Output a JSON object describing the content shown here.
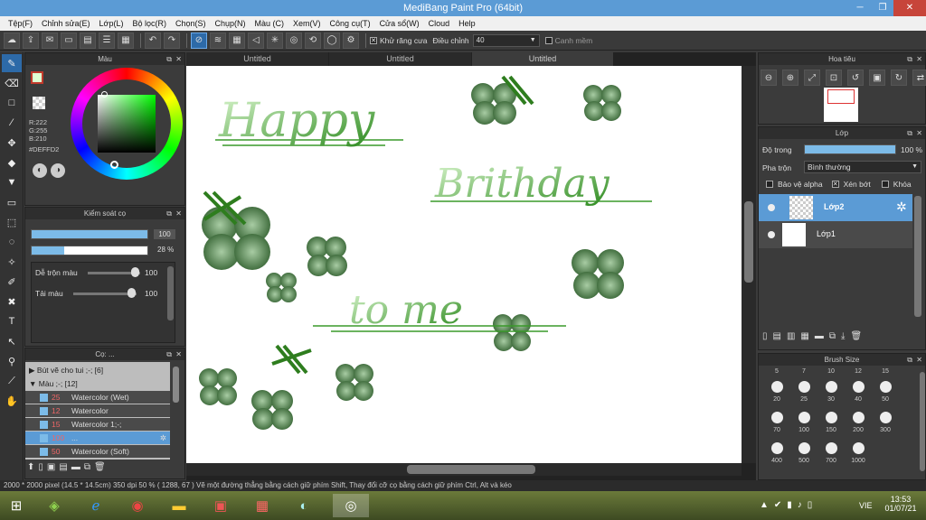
{
  "window": {
    "title": "MediBang Paint Pro (64bit)",
    "minimize": "─",
    "restore": "❐",
    "close": "✕"
  },
  "menu": [
    "Tệp(F)",
    "Chỉnh sửa(E)",
    "Lớp(L)",
    "Bộ lọc(R)",
    "Chọn(S)",
    "Chụp(N)",
    "Màu (C)",
    "Xem(V)",
    "Công cụ(T)",
    "Cửa sổ(W)",
    "Cloud",
    "Help"
  ],
  "toolbar": {
    "antialias_label": "Khử răng cưa",
    "correction_label": "Điều chỉnh",
    "correction_value": "40",
    "smooth_label": "Canh mềm"
  },
  "color_panel": {
    "title": "Màu",
    "r": "R:222",
    "g": "G:255",
    "b": "B:210",
    "hex": "#DEFFD2",
    "fg_color": "#DEFFD2"
  },
  "brush_control": {
    "title": "Kiểm soát cọ",
    "size_value": "100",
    "opacity_value": "28 %",
    "blend_label": "Dễ trộn màu",
    "blend_value": "100",
    "ink_label": "Tải màu",
    "ink_value": "100"
  },
  "brushes": {
    "title": "Cọ: ...",
    "groups": [
      {
        "label": "Bút vẽ cho tui ;-; [6]",
        "expanded": false
      },
      {
        "label": "Màu ;-; [12]",
        "expanded": true
      }
    ],
    "items": [
      {
        "size": "25",
        "name": "Watercolor (Wet)",
        "selected": false
      },
      {
        "size": "12",
        "name": "Watercolor",
        "selected": false
      },
      {
        "size": "15",
        "name": "Watercolor 1;-;",
        "selected": false
      },
      {
        "size": "100",
        "name": "...",
        "selected": true
      },
      {
        "size": "50",
        "name": "Watercolor (Soft)",
        "selected": false
      }
    ]
  },
  "tabs": [
    "Untitled",
    "Untitled",
    "Untitled"
  ],
  "canvas_text": [
    "Happy",
    "Brithday",
    "to me"
  ],
  "navigator": {
    "title": "Hoa tiêu"
  },
  "layers": {
    "title": "Lớp",
    "opacity_label": "Độ trong",
    "opacity_value": "100 %",
    "blend_label": "Pha trộn",
    "blend_value": "Bình thường",
    "alpha_label": "Bảo vệ alpha",
    "clip_label": "Xén bớt",
    "lock_label": "Khóa",
    "items": [
      {
        "name": "Lớp2",
        "selected": true
      },
      {
        "name": "Lớp1",
        "selected": false
      }
    ]
  },
  "brush_size": {
    "title": "Brush Size",
    "header": [
      "5",
      "7",
      "10",
      "12",
      "15"
    ],
    "rows": [
      [
        "20",
        "25",
        "30",
        "40",
        "50"
      ],
      [
        "70",
        "100",
        "150",
        "200",
        "300"
      ],
      [
        "400",
        "500",
        "700",
        "1000"
      ]
    ]
  },
  "status": "2000 * 2000 pixel   (14.5 * 14.5cm)   350 dpi   50 %   ( 1288, 67 )   Vẽ một đường thẳng bằng cách giữ phím Shift, Thay đổi cỡ cọ bằng cách giữ phím Ctrl, Alt và kéo",
  "taskbar": {
    "language": "VIE",
    "time": "13:53",
    "date": "01/07/21"
  },
  "colors": {
    "accent": "#5b9bd5",
    "selection": "#2d6aa8",
    "green": "#3a8a2a",
    "dark_green": "#2f5a2a"
  }
}
